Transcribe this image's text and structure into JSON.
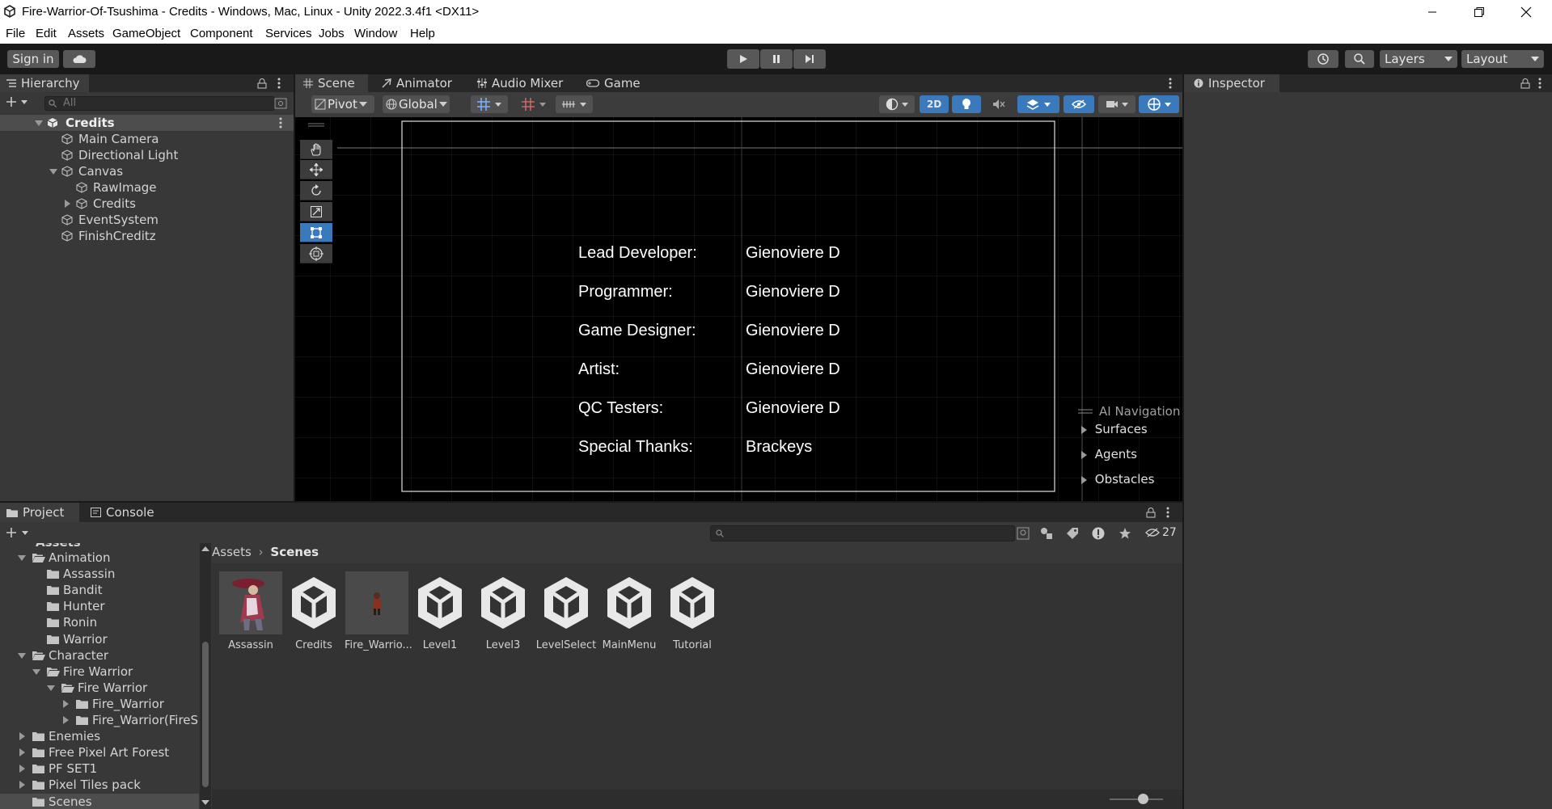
{
  "window": {
    "title": "Fire-Warrior-Of-Tsushima - Credits - Windows, Mac, Linux - Unity 2022.3.4f1 <DX11>"
  },
  "menu": [
    "File",
    "Edit",
    "Assets",
    "GameObject",
    "Component",
    "Services",
    "Jobs",
    "Window",
    "Help"
  ],
  "toolbar": {
    "sign_in": "Sign in",
    "layers": "Layers",
    "layout": "Layout"
  },
  "hierarchy": {
    "tab": "Hierarchy",
    "search_placeholder": "All",
    "items": [
      {
        "label": "Credits",
        "depth": 0
      },
      {
        "label": "Main Camera",
        "depth": 1
      },
      {
        "label": "Directional Light",
        "depth": 1
      },
      {
        "label": "Canvas",
        "depth": 1
      },
      {
        "label": "RawImage",
        "depth": 2
      },
      {
        "label": "Credits",
        "depth": 2
      },
      {
        "label": "EventSystem",
        "depth": 1
      },
      {
        "label": "FinishCreditz",
        "depth": 1
      }
    ]
  },
  "scene_tabs": [
    "Scene",
    "Animator",
    "Audio Mixer",
    "Game"
  ],
  "scene_toolbar": {
    "pivot": "Pivot",
    "global": "Global",
    "mode_2d": "2D"
  },
  "credits": [
    {
      "role": "Lead Developer:",
      "name": "Gienoviere D"
    },
    {
      "role": "Programmer:",
      "name": "Gienoviere D"
    },
    {
      "role": "Game Designer:",
      "name": "Gienoviere D"
    },
    {
      "role": "Artist:",
      "name": "Gienoviere D"
    },
    {
      "role": "QC Testers:",
      "name": "Gienoviere D"
    },
    {
      "role": "Special Thanks:",
      "name": "Brackeys"
    }
  ],
  "ai_navigation": {
    "title": "AI Navigation",
    "items": [
      "Surfaces",
      "Agents",
      "Obstacles"
    ]
  },
  "inspector": {
    "tab": "Inspector"
  },
  "project": {
    "tabs": [
      "Project",
      "Console"
    ],
    "hidden_count": "27",
    "breadcrumb": [
      "Assets",
      "Scenes"
    ],
    "tree_partial_top": "Assets",
    "tree": [
      {
        "label": "Animation",
        "depth": 1,
        "expanded": true
      },
      {
        "label": "Assassin",
        "depth": 2
      },
      {
        "label": "Bandit",
        "depth": 2
      },
      {
        "label": "Hunter",
        "depth": 2
      },
      {
        "label": "Ronin",
        "depth": 2
      },
      {
        "label": "Warrior",
        "depth": 2
      },
      {
        "label": "Character",
        "depth": 1,
        "expanded": true
      },
      {
        "label": "Fire Warrior",
        "depth": 2,
        "expanded": true
      },
      {
        "label": "Fire Warrior",
        "depth": 3,
        "expanded": true
      },
      {
        "label": "Fire_Warrior",
        "depth": 4,
        "collapsed": true
      },
      {
        "label": "Fire_Warrior(FireS",
        "depth": 4,
        "collapsed": true
      },
      {
        "label": "Enemies",
        "depth": 1,
        "collapsed": true
      },
      {
        "label": "Free Pixel Art Forest",
        "depth": 1,
        "collapsed": true
      },
      {
        "label": "PF SET1",
        "depth": 1,
        "collapsed": true
      },
      {
        "label": "Pixel Tiles pack",
        "depth": 1,
        "collapsed": true
      },
      {
        "label": "Scenes",
        "depth": 1,
        "selected": true
      }
    ],
    "assets": [
      {
        "label": "Assassin",
        "kind": "sprite-assassin"
      },
      {
        "label": "Credits",
        "kind": "unity-scene"
      },
      {
        "label": "Fire_Warrio...",
        "kind": "sprite-warrior"
      },
      {
        "label": "Level1",
        "kind": "unity-scene"
      },
      {
        "label": "Level3",
        "kind": "unity-scene"
      },
      {
        "label": "LevelSelect",
        "kind": "unity-scene"
      },
      {
        "label": "MainMenu",
        "kind": "unity-scene"
      },
      {
        "label": "Tutorial",
        "kind": "unity-scene"
      }
    ]
  },
  "colors": {
    "accent_blue": "#3a79bb",
    "panel": "#383838",
    "dark": "#191919"
  }
}
